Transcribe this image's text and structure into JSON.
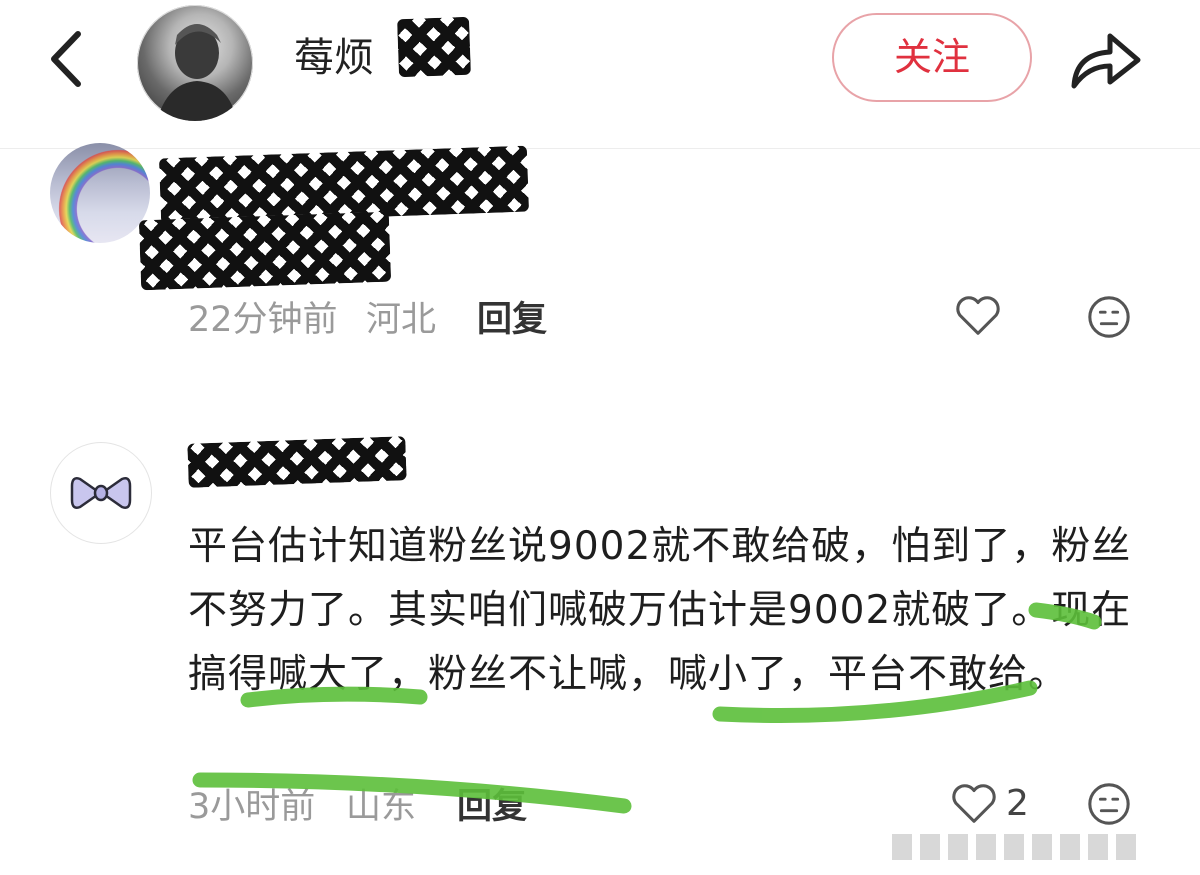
{
  "header": {
    "title": "莓烦",
    "follow_label": "关注",
    "icons": [
      "back-arrow-icon",
      "share-icon"
    ]
  },
  "comments": [
    {
      "time": "22分钟前",
      "location": "河北",
      "reply_label": "回复",
      "icons": [
        "heart-icon",
        "dislike-face-icon"
      ]
    },
    {
      "text": "平台估计知道粉丝说9002就不敢给破，怕到了，粉丝不努力了。其实咱们喊破万估计是9002就破了。现在搞得喊大了，粉丝不让喊，喊小了，平台不敢给。",
      "time": "3小时前",
      "location": "山东",
      "reply_label": "回复",
      "likes": "2",
      "icons": [
        "heart-icon",
        "dislike-face-icon"
      ]
    }
  ],
  "annotation_color": "#5cbf3a",
  "accent_color": "#e0313f"
}
